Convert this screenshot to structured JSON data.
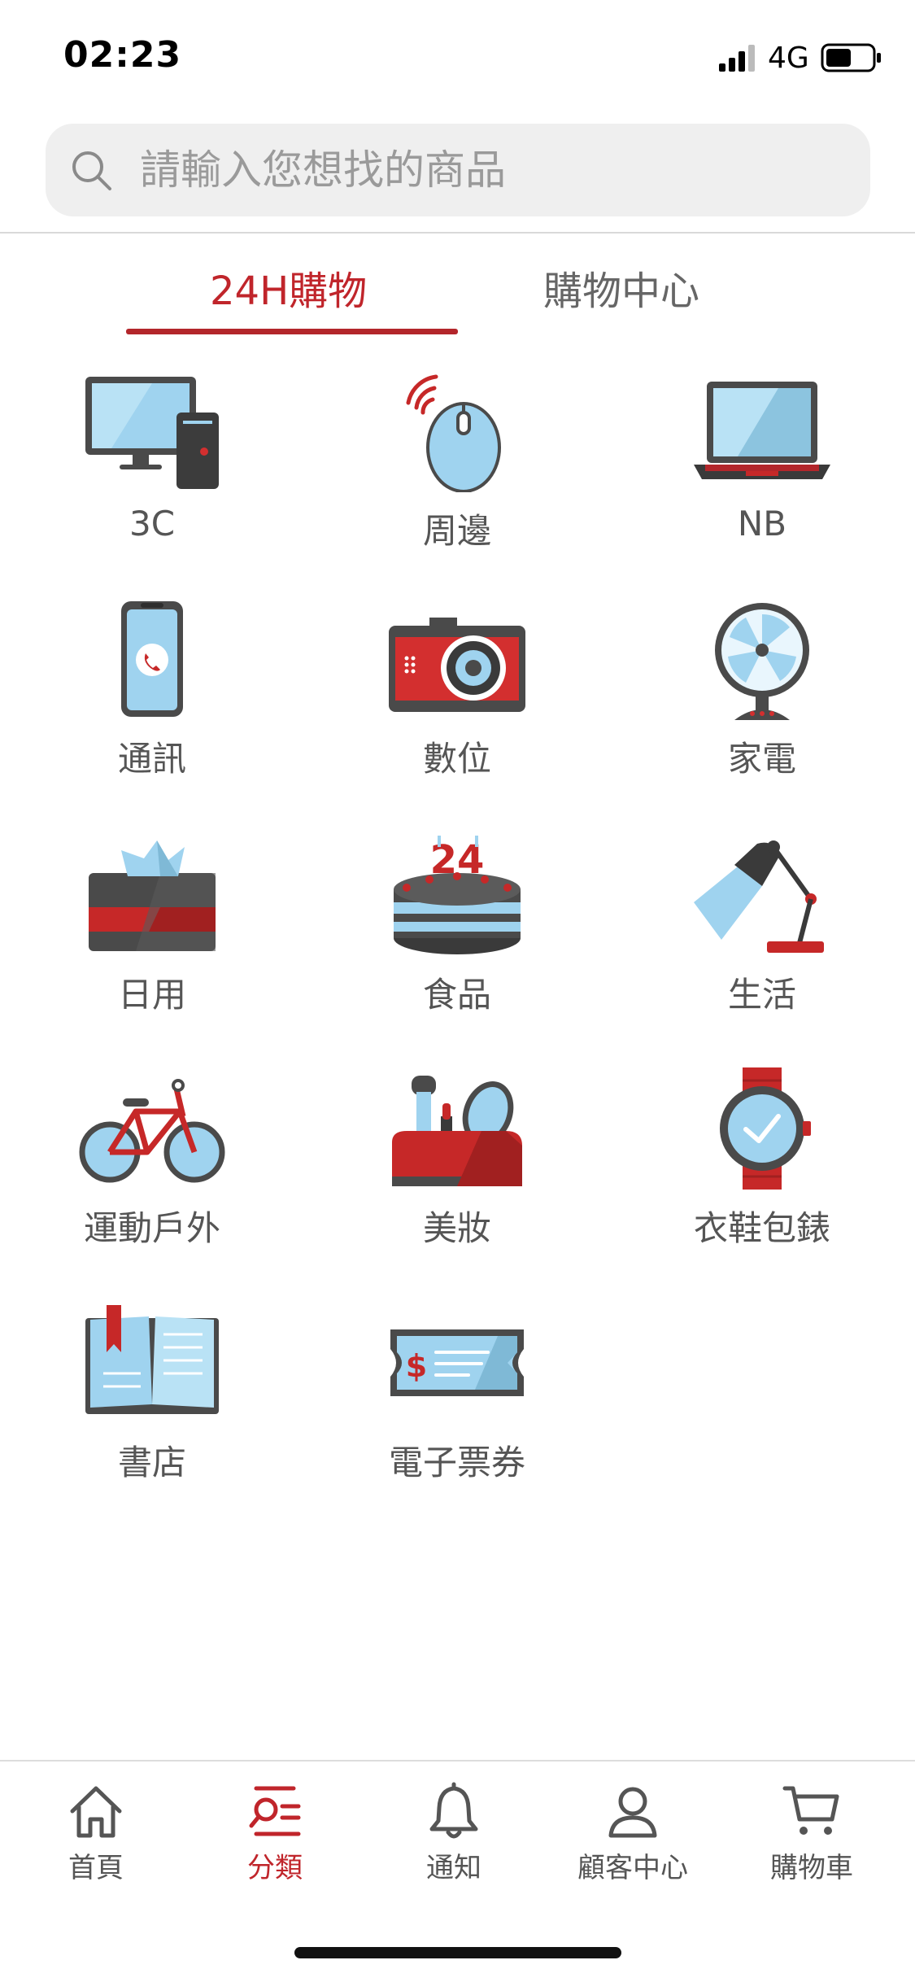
{
  "status": {
    "time": "02:23",
    "network": "4G",
    "battery_level": 0.55
  },
  "search": {
    "placeholder": "請輸入您想找的商品"
  },
  "tabs": [
    {
      "label": "24H購物",
      "active": true
    },
    {
      "label": "購物中心",
      "active": false
    }
  ],
  "categories": [
    {
      "label": "3C",
      "icon": "desktop-computer-icon"
    },
    {
      "label": "周邊",
      "icon": "wireless-mouse-icon"
    },
    {
      "label": "NB",
      "icon": "laptop-icon"
    },
    {
      "label": "通訊",
      "icon": "smartphone-icon"
    },
    {
      "label": "數位",
      "icon": "camera-icon"
    },
    {
      "label": "家電",
      "icon": "electric-fan-icon"
    },
    {
      "label": "日用",
      "icon": "tissue-box-icon"
    },
    {
      "label": "食品",
      "icon": "cake-icon"
    },
    {
      "label": "生活",
      "icon": "desk-lamp-icon"
    },
    {
      "label": "運動戶外",
      "icon": "bicycle-icon"
    },
    {
      "label": "美妝",
      "icon": "makeup-bag-icon"
    },
    {
      "label": "衣鞋包錶",
      "icon": "wristwatch-icon"
    },
    {
      "label": "書店",
      "icon": "open-book-icon"
    },
    {
      "label": "電子票券",
      "icon": "ticket-icon"
    }
  ],
  "bottom_nav": [
    {
      "label": "首頁",
      "icon": "home-icon",
      "active": false
    },
    {
      "label": "分類",
      "icon": "category-icon",
      "active": true
    },
    {
      "label": "通知",
      "icon": "bell-icon",
      "active": false
    },
    {
      "label": "顧客中心",
      "icon": "user-icon",
      "active": false
    },
    {
      "label": "購物車",
      "icon": "cart-icon",
      "active": false
    }
  ],
  "colors": {
    "accent": "#c0252b",
    "icon_blue": "#9fd3ef",
    "icon_dark": "#4a4a4a",
    "icon_red": "#c62828",
    "search_bg": "#efefef"
  }
}
